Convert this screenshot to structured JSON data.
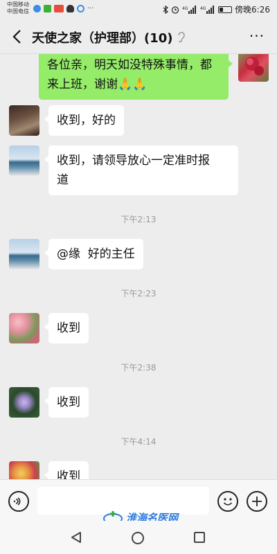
{
  "status_bar": {
    "carrier_1": "中国移动",
    "carrier_2": "中国电信",
    "time": "傍晚6:26"
  },
  "header": {
    "title": "天使之家（护理部）(10)",
    "back_icon": "back-arrow-icon",
    "mute_icon": "ear-icon",
    "more_icon": "more-dots-icon"
  },
  "messages": [
    {
      "sender": "self",
      "text_line1": "各位亲，明天如没特殊事情，都",
      "text_line2": "来上班，谢谢🙏🙏"
    },
    {
      "sender": "other",
      "text": "收到，好的"
    },
    {
      "sender": "other",
      "text_line1": "收到，请领导放心一定准时报",
      "text_line2": "道"
    },
    {
      "type": "time",
      "text": "下午2:13"
    },
    {
      "sender": "other",
      "text": "@缘  好的主任"
    },
    {
      "type": "time",
      "text": "下午2:23"
    },
    {
      "sender": "other",
      "text": "收到"
    },
    {
      "type": "time",
      "text": "下午2:38"
    },
    {
      "sender": "other",
      "text": "收到"
    },
    {
      "type": "time",
      "text": "下午4:14"
    },
    {
      "sender": "other",
      "text": "收到"
    }
  ],
  "input_bar": {
    "voice_icon": "voice-icon",
    "emoji_icon": "emoji-icon",
    "plus_icon": "plus-icon",
    "value": ""
  },
  "watermark": "淮海名医网",
  "colors": {
    "background": "#ededed",
    "self_bubble": "#95ec69",
    "other_bubble": "#ffffff",
    "watermark": "#2b7de0"
  }
}
